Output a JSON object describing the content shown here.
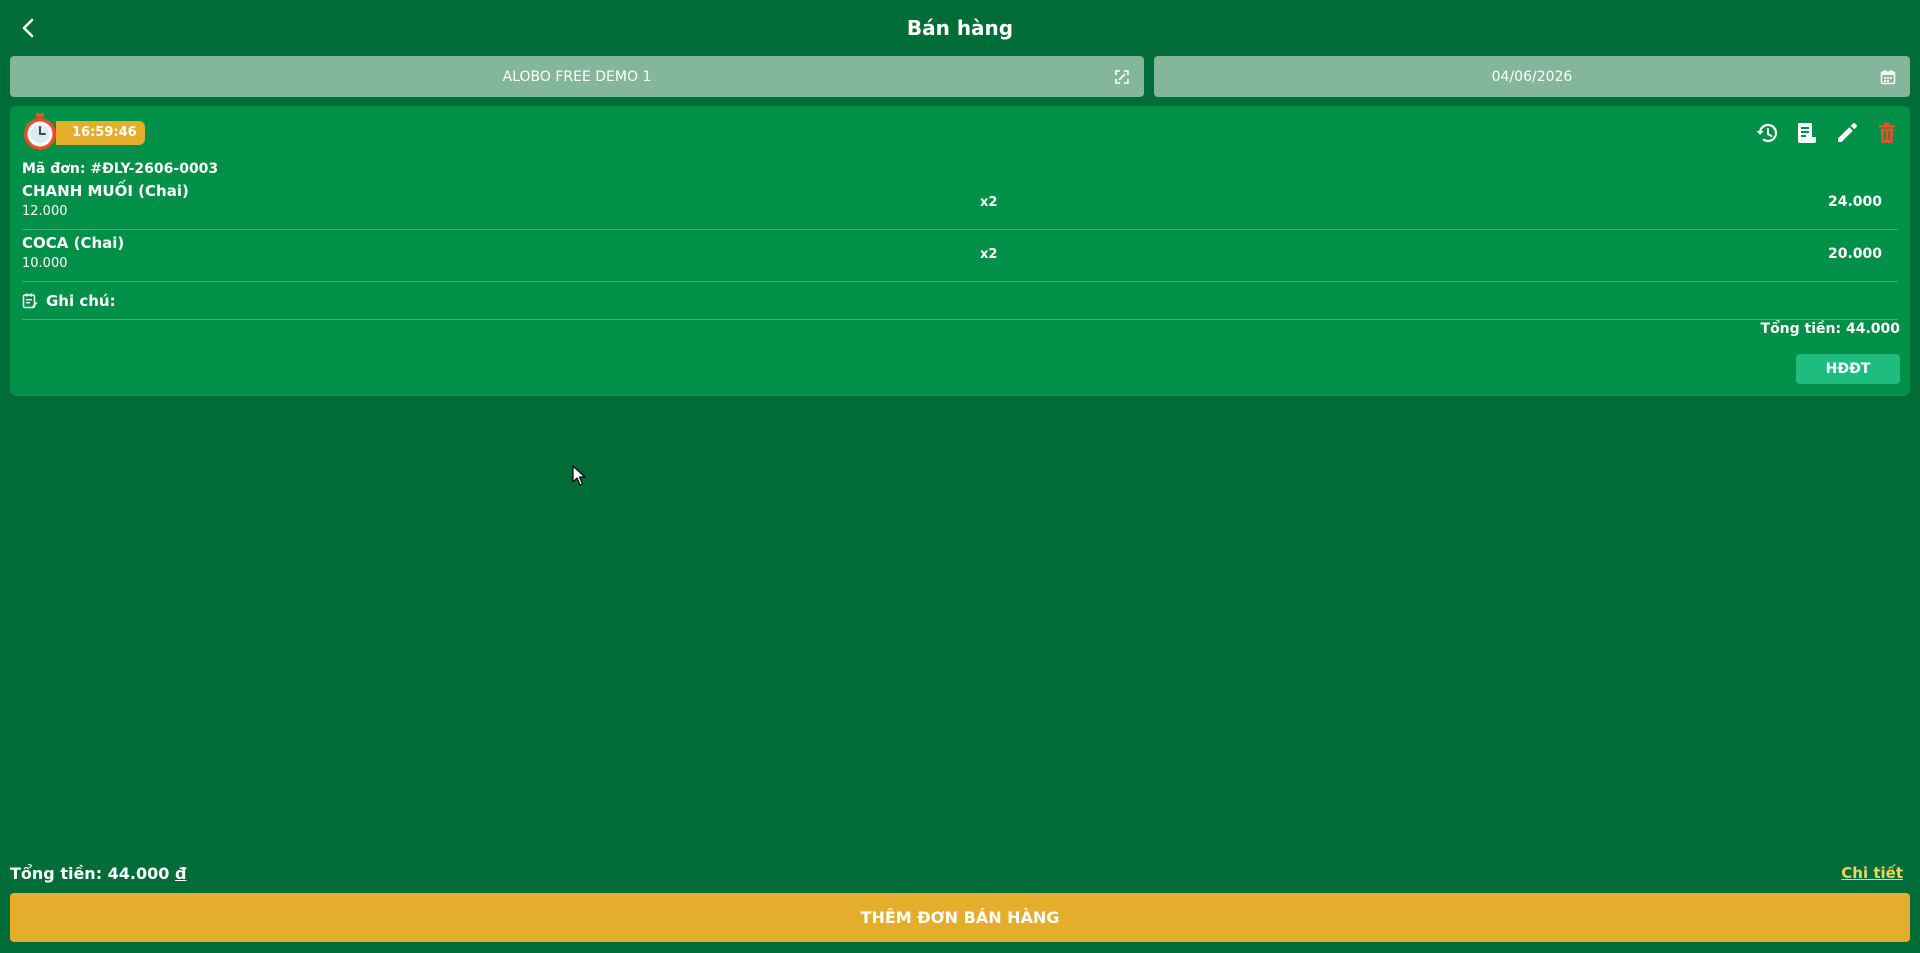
{
  "header": {
    "title": "Bán hàng",
    "back_icon": "chevron-left-icon"
  },
  "store_selector": {
    "value": "ALOBO FREE DEMO 1",
    "icon": "scan-icon"
  },
  "date_selector": {
    "value": "04/06/2026",
    "icon": "calendar-icon"
  },
  "order": {
    "time": "16:59:46",
    "code": "Mã đơn: #ĐLY-2606-0003",
    "items": [
      {
        "name": "CHANH MUỐI (Chai)",
        "price": "12.000",
        "qty": "x2",
        "amount": "24.000"
      },
      {
        "name": "COCA (Chai)",
        "price": "10.000",
        "qty": "x2",
        "amount": "20.000"
      }
    ],
    "note_label": "Ghi chú:",
    "total": "Tổng tiền: 44.000",
    "einvoice_button": "HĐĐT",
    "actions": [
      "history-icon",
      "receipt-icon",
      "edit-icon",
      "trash-icon"
    ]
  },
  "footer": {
    "total_label": "Tổng tiền: 44.000",
    "currency": "đ",
    "detail_link": "Chi tiết",
    "add_order_button": "THÊM ĐƠN BÁN HÀNG"
  },
  "colors": {
    "background": "#006d38",
    "card": "#009047",
    "accent": "#e4ad2b",
    "selector": "#84b69c",
    "einvoice": "#1fbc80",
    "danger": "#e8502b"
  }
}
